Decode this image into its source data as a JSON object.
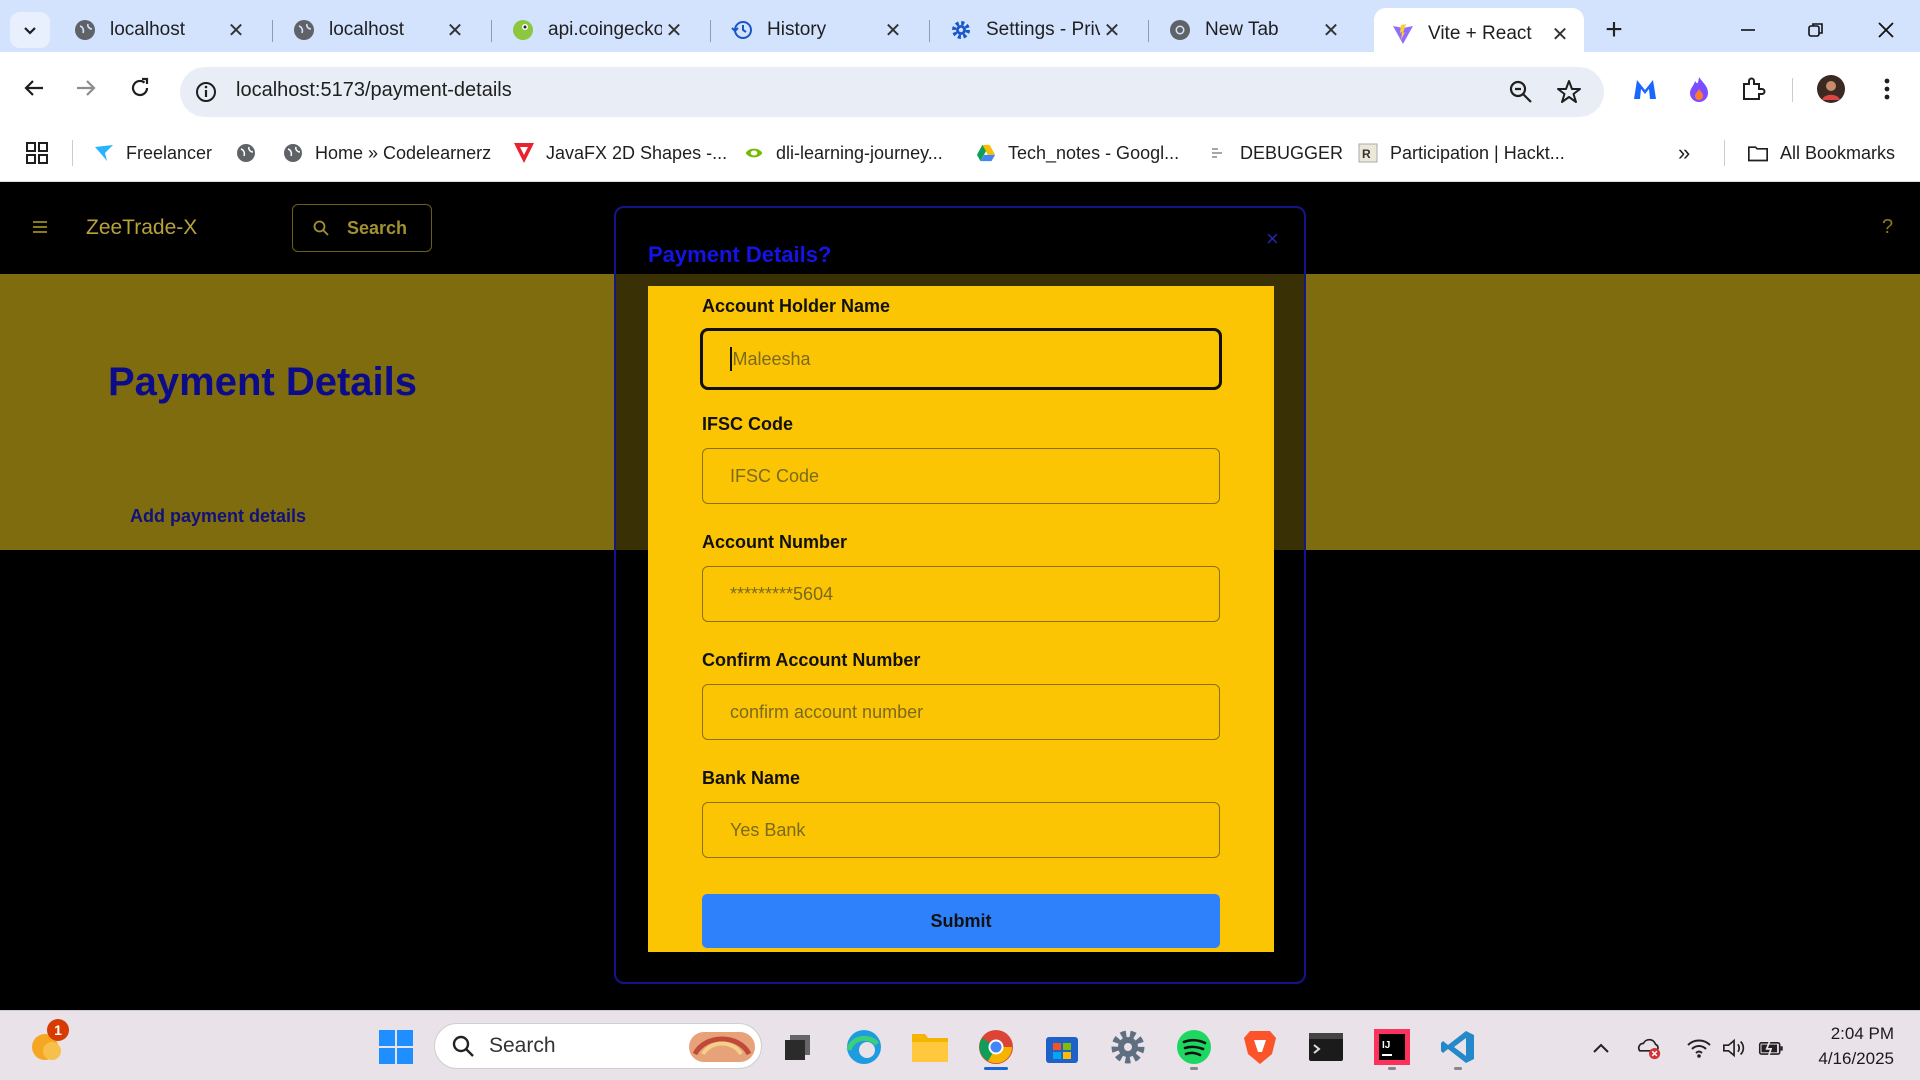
{
  "browser": {
    "tabs": [
      {
        "label": "localhost",
        "icon": "globe-icon",
        "active": false
      },
      {
        "label": "localhost",
        "icon": "globe-icon",
        "active": false
      },
      {
        "label": "api.coingecko",
        "icon": "coingecko-icon",
        "active": false
      },
      {
        "label": "History",
        "icon": "history-icon",
        "active": false
      },
      {
        "label": "Settings - Priv",
        "icon": "settings-gear-icon",
        "active": false
      },
      {
        "label": "New Tab",
        "icon": "chrome-icon",
        "active": false
      },
      {
        "label": "Vite + React",
        "icon": "vite-icon",
        "active": true
      }
    ],
    "url": "localhost:5173/payment-details",
    "bookmarks": [
      {
        "label": "Freelancer",
        "icon": "freelancer-icon"
      },
      {
        "label": "",
        "icon": "globe-icon"
      },
      {
        "label": "Home » Codelearnerz",
        "icon": "globe-icon"
      },
      {
        "label": "JavaFX 2D Shapes -...",
        "icon": "javafx-icon"
      },
      {
        "label": "dli-learning-journey...",
        "icon": "nvidia-icon"
      },
      {
        "label": "Tech_notes - Googl...",
        "icon": "google-drive-icon"
      },
      {
        "label": "DEBUGGER",
        "icon": "debugger-icon"
      },
      {
        "label": "Participation | Hackt...",
        "icon": "hackerrank-icon"
      }
    ],
    "all_bookmarks": "All Bookmarks"
  },
  "app": {
    "brand": "ZeeTrade-X",
    "search_label": "Search",
    "help": "?",
    "page_title": "Payment Details",
    "add_link": "Add payment details",
    "modal": {
      "title": "Payment Details?",
      "close": "×",
      "fields": [
        {
          "label": "Account Holder Name",
          "placeholder": "Maleesha",
          "focused": true
        },
        {
          "label": "IFSC Code",
          "placeholder": "IFSC Code",
          "focused": false
        },
        {
          "label": "Account Number",
          "placeholder": "*********5604",
          "focused": false
        },
        {
          "label": "Confirm Account Number",
          "placeholder": "confirm account number",
          "focused": false
        },
        {
          "label": "Bank Name",
          "placeholder": "Yes Bank",
          "focused": false
        }
      ],
      "submit": "Submit"
    }
  },
  "taskbar": {
    "search_label": "Search",
    "weather_badge": "1",
    "time": "2:04 PM",
    "date": "4/16/2025"
  },
  "colors": {
    "accent_yellow": "#fcc503",
    "banner_olive": "#7f6c0e",
    "title_blue": "#0c0c8a",
    "submit_blue": "#2f80fb"
  }
}
